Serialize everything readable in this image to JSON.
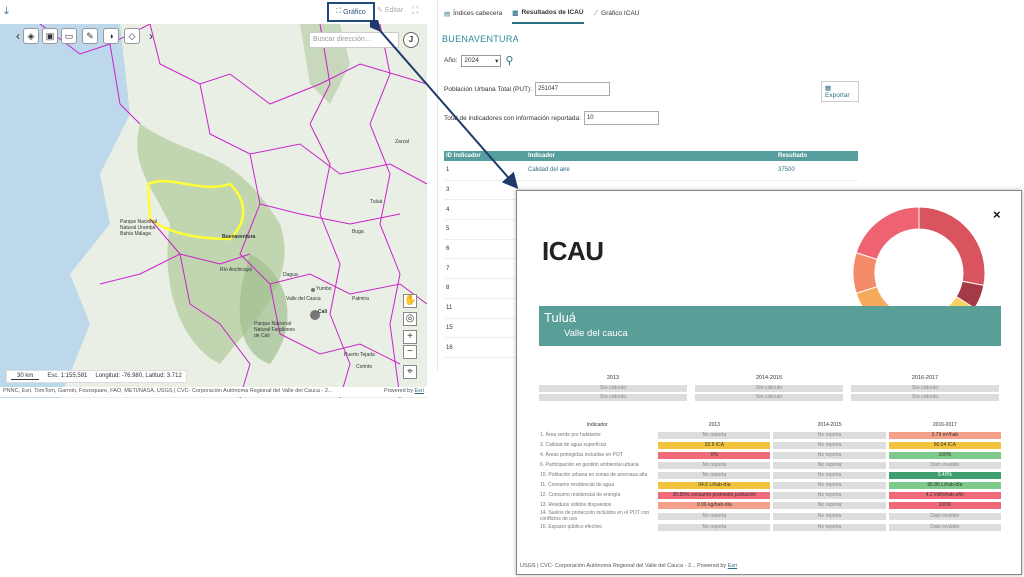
{
  "toolbar": {
    "grafico_label": "Gráfico",
    "editar_label": "Editar"
  },
  "map": {
    "search_placeholder": "Buscar dirección...",
    "j_label": "J",
    "scale_label": "30 km",
    "scale_text": "Esc. 1:155,581",
    "coords": "Longitud: -76.980, Latitud: 3.712",
    "attribution": "PNNC, Esri, TomTom, Garmin, Foursquare, FAO, METI/NASA, USGS | CVC- Corporación Autónoma Regional del Valle del Cauca - 2...",
    "powered": "Powered by",
    "esri": "Esri",
    "labels": {
      "buenaventura": "Buenaventura",
      "tulua": "Tuluá",
      "buga": "Buga",
      "cali": "Cali",
      "palmira": "Palmira",
      "yumbo": "Yumbo",
      "dagua": "Dagua",
      "zarzal": "Zarzal",
      "park": "Parque Nacional Natural Uramba Bahía Málaga",
      "anchicaya": "Río Anchicayá",
      "farallones": "Parque Nacional Natural Farallones de Cali",
      "puerto_tejada": "Puerto Tejada",
      "corinto": "Corinto",
      "valle_cauca": "Valle del Cauca"
    },
    "colors": {
      "water": "#bcd8ea",
      "land": "#e9efe4",
      "forest": "#b7cfa2",
      "border": "#cc22cc",
      "highlight": "#ffff33"
    }
  },
  "panel": {
    "tabs": [
      {
        "label": "Índices cabecera",
        "active": false
      },
      {
        "label": "Resultados de ICAU",
        "active": true
      },
      {
        "label": "Gráfico ICAU",
        "active": false
      }
    ],
    "city": "BUENAVENTURA",
    "year_label": "Año:",
    "year_value": "2024",
    "put_label": "Población Urbana Total (PUT):",
    "put_value": "251047",
    "export_label": "Exportar",
    "total_label": "Total de indicadores con información reportada:",
    "total_value": "10",
    "table": {
      "headers": [
        "ID Indicador",
        "Indicador",
        "Resultado"
      ],
      "rows": [
        {
          "id": "1",
          "name": "Calidad del aire",
          "value": "37500"
        },
        {
          "id": "3",
          "name": "",
          "value": ""
        },
        {
          "id": "4",
          "name": "",
          "value": ""
        },
        {
          "id": "5",
          "name": "",
          "value": ""
        },
        {
          "id": "6",
          "name": "",
          "value": ""
        },
        {
          "id": "7",
          "name": "",
          "value": ""
        },
        {
          "id": "8",
          "name": "",
          "value": ""
        },
        {
          "id": "11",
          "name": "",
          "value": ""
        },
        {
          "id": "15",
          "name": "",
          "value": ""
        },
        {
          "id": "16",
          "name": "",
          "value": ""
        }
      ]
    }
  },
  "modal": {
    "title": "ICAU",
    "close": "×",
    "municipality": "Tuluá",
    "department": "Valle del cauca",
    "periods": [
      {
        "year": "2013",
        "rows": [
          "Sin cálculo",
          "Sin cálculo"
        ]
      },
      {
        "year": "2014-2015",
        "rows": [
          "Sin cálculo",
          "Sin cálculo"
        ]
      },
      {
        "year": "2016-2017",
        "rows": [
          "Sin cálculo",
          "Sin cálculo"
        ]
      }
    ],
    "indicators_header": [
      "Indicador",
      "2013",
      "2014-2015",
      "2016-2017"
    ],
    "indicators": [
      {
        "name": "1. Área verde por habitante",
        "v": [
          "No reporta",
          "No reporta",
          "3.79 m²/hab"
        ],
        "c": [
          "nr",
          "nr",
          "orange"
        ]
      },
      {
        "name": "3. Calidad de agua superficial",
        "v": [
          "32.9 ICA",
          "No reporta",
          "60.54 ICA"
        ],
        "c": [
          "yellow",
          "nr",
          "yellow"
        ]
      },
      {
        "name": "4. Áreas protegidas incluidas en POT",
        "v": [
          "0%",
          "No reporta",
          "100%"
        ],
        "c": [
          "red",
          "nr",
          "green"
        ]
      },
      {
        "name": "6. Participación en gestión ambiental urbana",
        "v": [
          "No reporta",
          "No reporta",
          "Dato inválido"
        ],
        "c": [
          "nr",
          "nr",
          "nr"
        ]
      },
      {
        "name": "10. Población urbana en zonas de amenaza alta",
        "v": [
          "No reporta",
          "No reporta",
          "0.40%"
        ],
        "c": [
          "nr",
          "nr",
          "dgreen"
        ]
      },
      {
        "name": "11. Consumo residencial de agua",
        "v": [
          "94.6 L/hab-día",
          "No reporta",
          "96.86 L/hab-día"
        ],
        "c": [
          "yellow",
          "nr",
          "green"
        ]
      },
      {
        "name": "12. Consumo residencial de energía",
        "v": [
          "35.89% consumo promedio población",
          "No reporta",
          "4.2 kWh/hab-año"
        ],
        "c": [
          "red",
          "nr",
          "red"
        ]
      },
      {
        "name": "13. Residuos sólidos dispuestos",
        "v": [
          "0.96 kg/hab-día",
          "No reporta",
          "100%"
        ],
        "c": [
          "orange",
          "nr",
          "red"
        ]
      },
      {
        "name": "14. Suelos de protección incluidos en el POT con conflictos de uso",
        "v": [
          "No reporta",
          "No reporta",
          "Dato inválido"
        ],
        "c": [
          "nr",
          "nr",
          "nr"
        ]
      },
      {
        "name": "16. Espacio público efectivo",
        "v": [
          "No reporta",
          "No reporta",
          "Dato inválido"
        ],
        "c": [
          "nr",
          "nr",
          "nr"
        ]
      }
    ],
    "donut": [
      {
        "value": 28,
        "color": "#d9545e"
      },
      {
        "value": 6,
        "color": "#a33a45"
      },
      {
        "value": 22,
        "color": "#f9d262"
      },
      {
        "value": 14,
        "color": "#f7a95c"
      },
      {
        "value": 10,
        "color": "#f48c6a"
      },
      {
        "value": 20,
        "color": "#ee6272"
      }
    ],
    "footer_attrib": "USGS | CVC- Corporación Autónoma Regional del Valle del Cauca - 2...",
    "footer_powered": "Powered by",
    "footer_esri": "Esri"
  }
}
